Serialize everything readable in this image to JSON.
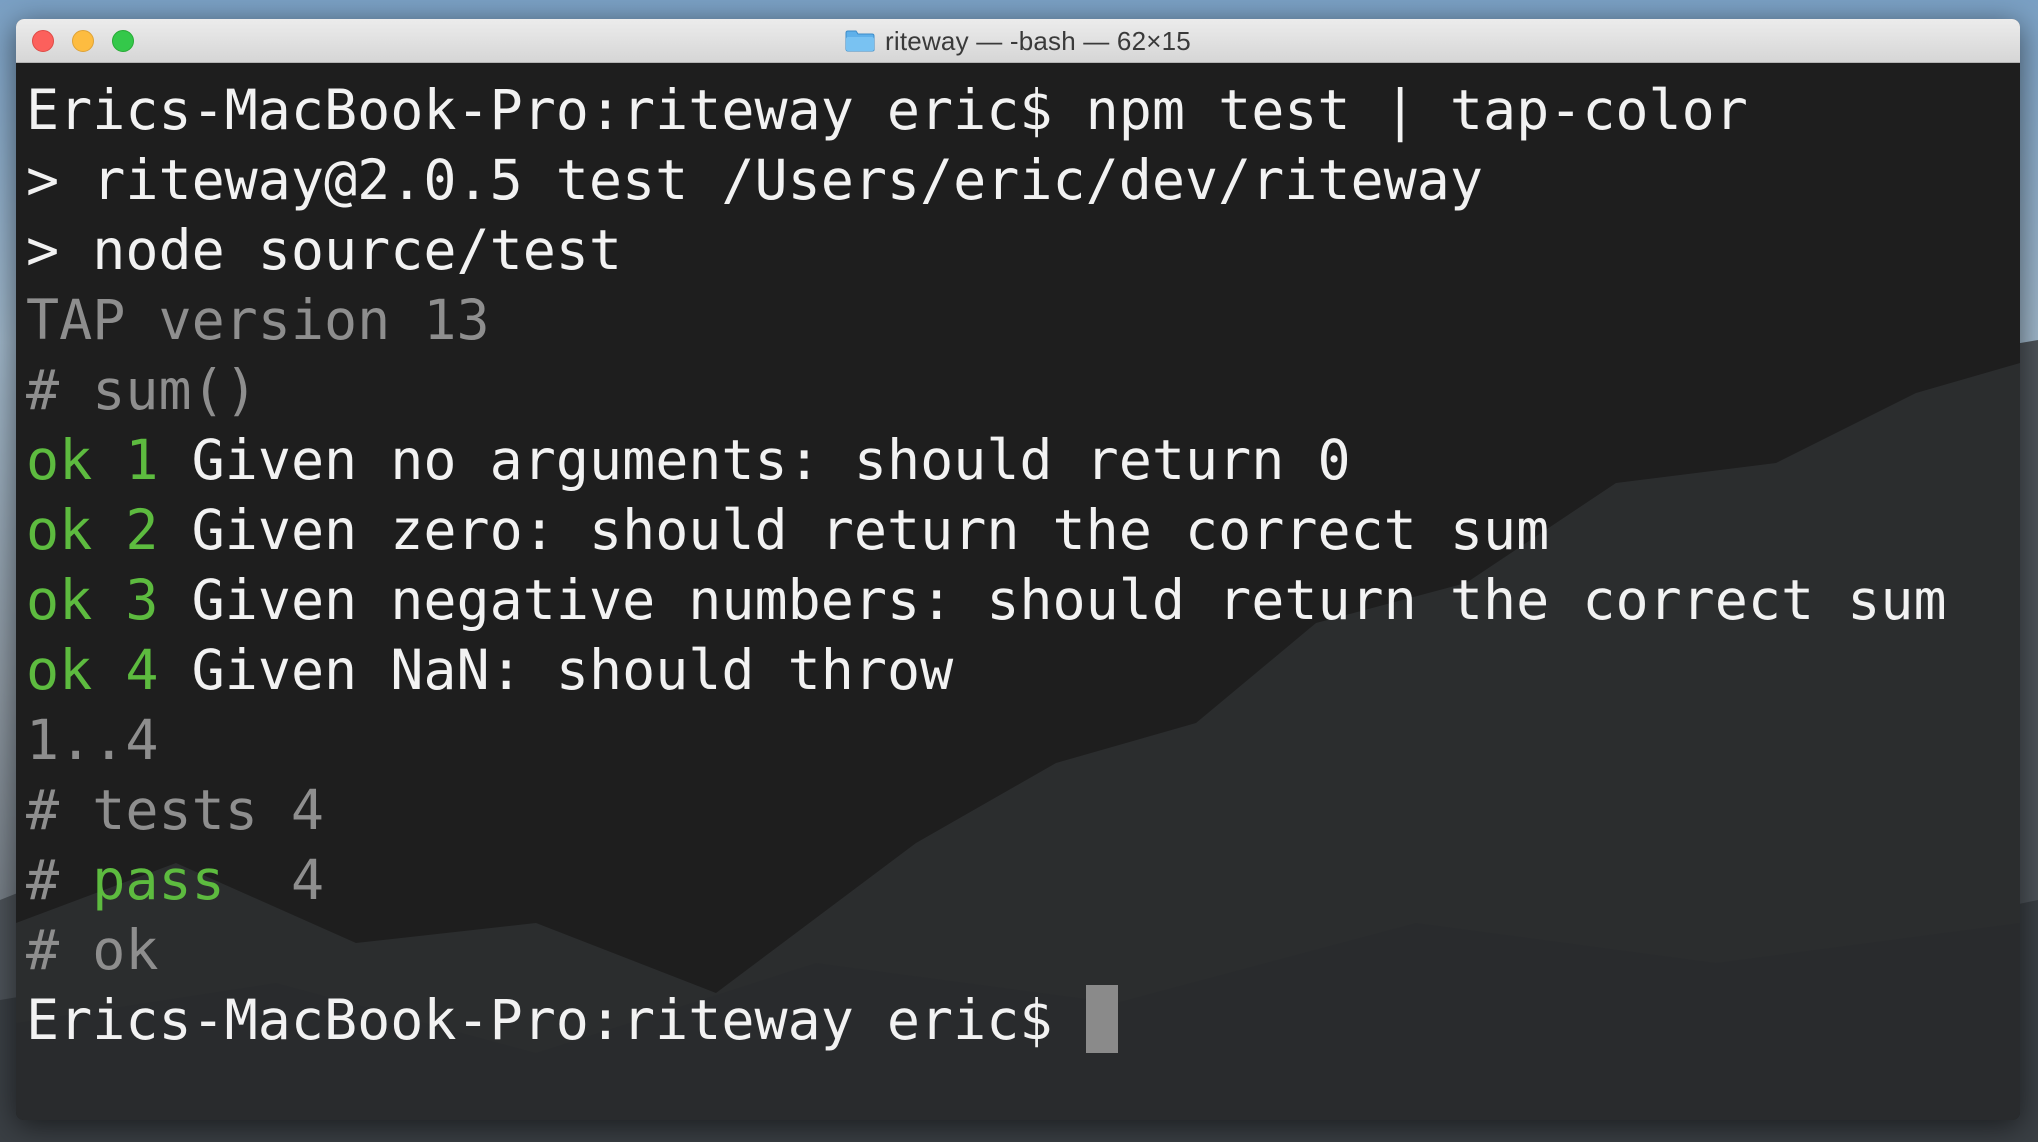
{
  "window": {
    "title": "riteway — -bash — 62×15",
    "folder_icon": "folder-icon"
  },
  "terminal": {
    "prompt": "Erics-MacBook-Pro:riteway eric$",
    "command": "npm test | tap-color",
    "script_line_1": "> riteway@2.0.5 test /Users/eric/dev/riteway",
    "script_line_2": "> node source/test",
    "tap_version": "TAP version 13",
    "suite_header": "# sum()",
    "results": [
      {
        "status": "ok",
        "number": "1",
        "description": "Given no arguments: should return 0"
      },
      {
        "status": "ok",
        "number": "2",
        "description": "Given zero: should return the correct sum"
      },
      {
        "status": "ok",
        "number": "3",
        "description": "Given negative numbers: should return the correct sum"
      },
      {
        "status": "ok",
        "number": "4",
        "description": "Given NaN: should throw"
      }
    ],
    "plan": "1..4",
    "summary_tests_hash": "#",
    "summary_tests": "tests 4",
    "summary_pass_hash": "#",
    "summary_pass_label": "pass",
    "summary_pass_count": "4",
    "summary_ok": "# ok",
    "final_prompt": "Erics-MacBook-Pro:riteway eric$"
  },
  "colors": {
    "pass_green": "#5dbb3f",
    "dim_gray": "#8e8e8e",
    "text_white": "#f2f2f2",
    "terminal_bg": "#1f1f1f"
  }
}
